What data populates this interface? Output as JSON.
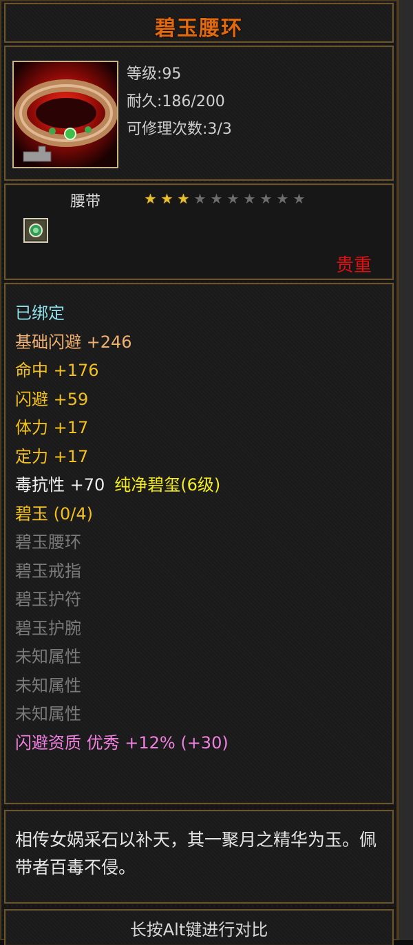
{
  "item": {
    "name": "碧玉腰环",
    "level": "等级:95",
    "durability": "耐久:186/200",
    "repairs": "可修理次数:3/3",
    "type": "腰带",
    "stars_total": 10,
    "stars_filled": 3,
    "rarity": "贵重"
  },
  "attributes": [
    {
      "text": "已绑定",
      "color": "#8fe0ea"
    },
    {
      "text": "基础闪避  +246",
      "color": "#f0b070"
    },
    {
      "text": "命中  +176",
      "color": "#f4c020"
    },
    {
      "text": "闪避  +59",
      "color": "#f4c020"
    },
    {
      "text": "体力  +17",
      "color": "#f4c020"
    },
    {
      "text": "定力  +17",
      "color": "#f4c020"
    },
    {
      "text": "毒抗性  +70",
      "color": "#f0f0f0",
      "extra": "纯净碧玺(6级)",
      "extra_color": "#f4ec20"
    },
    {
      "text": "碧玉 (0/4)",
      "color": "#f4c020"
    },
    {
      "text": "碧玉腰环",
      "color": "#7a7a7a"
    },
    {
      "text": "碧玉戒指",
      "color": "#7a7a7a"
    },
    {
      "text": "碧玉护符",
      "color": "#7a7a7a"
    },
    {
      "text": "碧玉护腕",
      "color": "#7a7a7a"
    },
    {
      "text": "未知属性",
      "color": "#7a7a7a"
    },
    {
      "text": "未知属性",
      "color": "#7a7a7a"
    },
    {
      "text": "未知属性",
      "color": "#7a7a7a"
    },
    {
      "text": "闪避资质   优秀  +12% (+30)",
      "color": "#f080e0"
    }
  ],
  "description": "相传女娲采石以补天，其一聚月之精华为玉。佩带者百毒不侵。",
  "footer": "长按Alt键进行对比",
  "icons": {
    "item": "jade-belt-icon",
    "gem": "jade-gem-icon"
  }
}
